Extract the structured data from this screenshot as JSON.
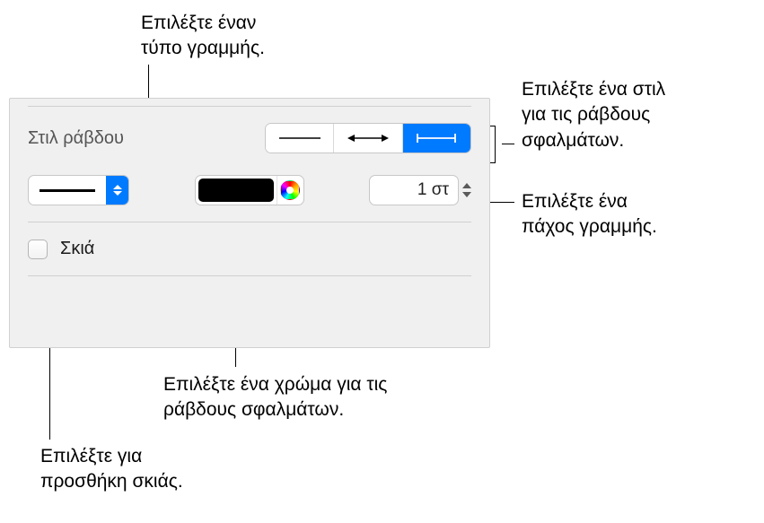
{
  "callouts": {
    "line_type": "Επιλέξτε έναν\nτύπο γραμμής.",
    "bar_style": "Επιλέξτε ένα στιλ\nγια τις ράβδους\nσφαλμάτων.",
    "line_width": "Επιλέξτε ένα\nπάχος γραμμής.",
    "color": "Επιλέξτε ένα χρώμα για τις\nράβδους σφαλμάτων.",
    "shadow": "Επιλέξτε για\nπροσθήκη σκιάς."
  },
  "panel": {
    "bar_style_label": "Στιλ ράβδου",
    "line_width_value": "1 στ",
    "shadow_label": "Σκιά",
    "color_value": "#000000"
  }
}
